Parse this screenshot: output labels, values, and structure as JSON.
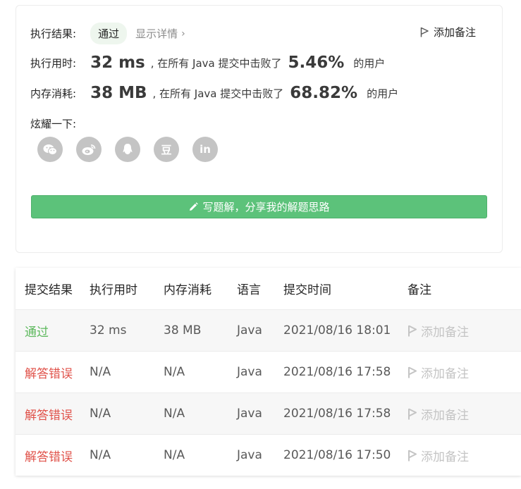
{
  "result": {
    "label": "执行结果:",
    "status": "通过",
    "details_link": "显示详情",
    "add_note": "添加备注"
  },
  "runtime": {
    "label": "执行用时:",
    "value": "32 ms",
    "mid": ", 在所有 Java 提交中击败了",
    "percent": "5.46%",
    "tail": "的用户"
  },
  "memory": {
    "label": "内存消耗:",
    "value": "38 MB",
    "mid": ", 在所有 Java 提交中击败了",
    "percent": "68.82%",
    "tail": "的用户"
  },
  "share": {
    "label": "炫耀一下:",
    "icons": [
      "wechat-icon",
      "weibo-icon",
      "qq-icon",
      "douban-icon",
      "linkedin-icon"
    ],
    "douban_glyph": "豆",
    "linkedin_glyph": "in"
  },
  "write_button": "写题解，分享我的解题思路",
  "table": {
    "headers": [
      "提交结果",
      "执行用时",
      "内存消耗",
      "语言",
      "提交时间",
      "备注"
    ],
    "rows": [
      {
        "status": "通过",
        "time": "32 ms",
        "memory": "38 MB",
        "lang": "Java",
        "submitted": "2021/08/16 18:01",
        "note": "添加备注"
      },
      {
        "status": "解答错误",
        "time": "N/A",
        "memory": "N/A",
        "lang": "Java",
        "submitted": "2021/08/16 17:58",
        "note": "添加备注"
      },
      {
        "status": "解答错误",
        "time": "N/A",
        "memory": "N/A",
        "lang": "Java",
        "submitted": "2021/08/16 17:58",
        "note": "添加备注"
      },
      {
        "status": "解答错误",
        "time": "N/A",
        "memory": "N/A",
        "lang": "Java",
        "submitted": "2021/08/16 17:50",
        "note": "添加备注"
      }
    ]
  },
  "colors": {
    "accepted": "#5cb85c",
    "wrong_answer": "#e0524a",
    "button_green": "#5cc27a",
    "icon_grey": "#c4c4c4"
  }
}
